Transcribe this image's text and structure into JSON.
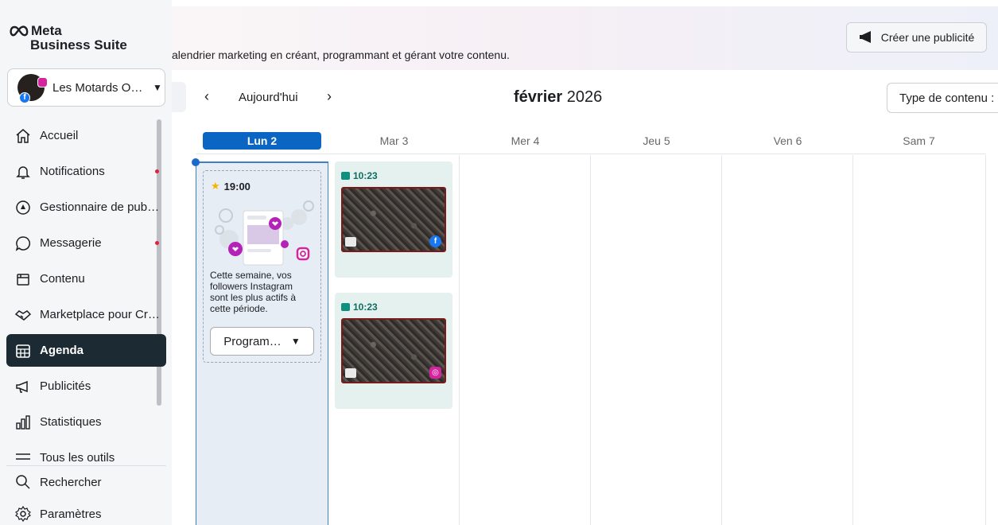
{
  "brand": {
    "meta": "Meta",
    "suite": "Business Suite"
  },
  "account": {
    "name": "Les Motards O…"
  },
  "nav": {
    "items": [
      {
        "label": "Accueil"
      },
      {
        "label": "Notifications"
      },
      {
        "label": "Gestionnaire de pub…"
      },
      {
        "label": "Messagerie"
      },
      {
        "label": "Contenu"
      },
      {
        "label": "Marketplace pour Cr…"
      },
      {
        "label": "Agenda"
      },
      {
        "label": "Publicités"
      },
      {
        "label": "Statistiques"
      },
      {
        "label": "Tous les outils"
      }
    ],
    "bottom": [
      {
        "label": "Rechercher"
      },
      {
        "label": "Paramètres"
      }
    ]
  },
  "banner": {
    "text": "alendrier marketing en créant, programmant et gérant votre contenu.",
    "create_ad_label": "Créer une publicité"
  },
  "calendar": {
    "today_label": "Aujourd'hui",
    "month": "février",
    "year": "2026",
    "content_type_label": "Type de contenu :",
    "days": [
      "Lun 2",
      "Mar 3",
      "Mer 4",
      "Jeu 5",
      "Ven 6",
      "Sam 7"
    ]
  },
  "suggestion": {
    "time": "19:00",
    "message": "Cette semaine, vos followers Instagram sont les plus actifs à cette période.",
    "button_label": "Program…"
  },
  "posts": [
    {
      "time": "10:23",
      "network": "facebook"
    },
    {
      "time": "10:23",
      "network": "instagram"
    }
  ],
  "colors": {
    "active_nav": "#1c2b33",
    "today_day": "#0a66c2",
    "post_bg": "#e5f1ee",
    "monday_bg": "#e7edf5"
  }
}
